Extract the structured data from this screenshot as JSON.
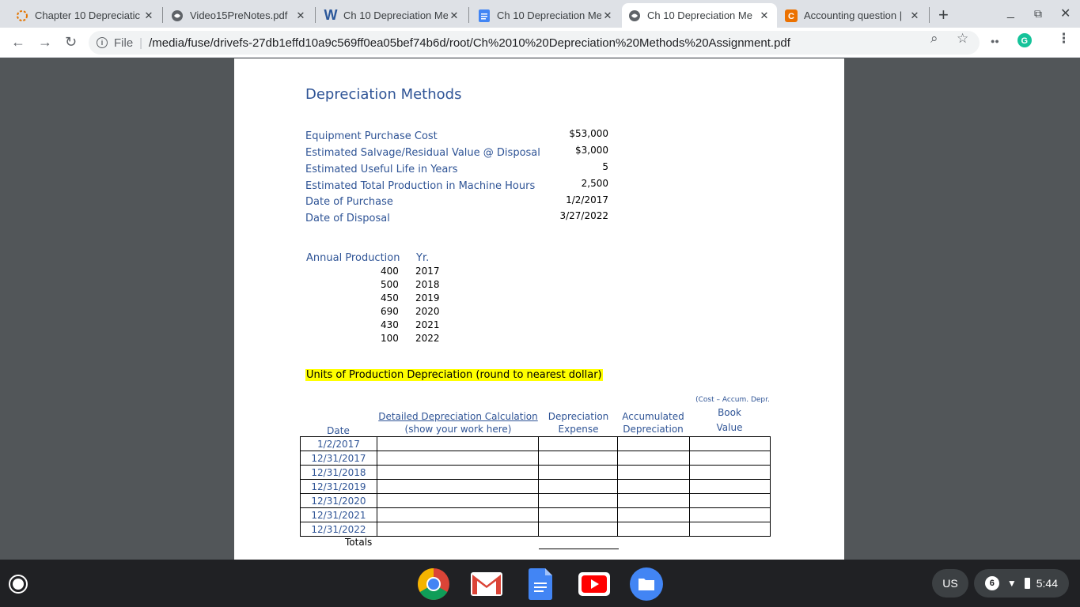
{
  "tabs": [
    {
      "title": "Chapter 10 Depreciatic",
      "icon": "loading-ring-icon",
      "active": false
    },
    {
      "title": "Video15PreNotes.pdf",
      "icon": "globe-icon",
      "active": false
    },
    {
      "title": "Ch 10 Depreciation Me",
      "icon": "word-icon",
      "active": false
    },
    {
      "title": "Ch 10 Depreciation Me",
      "icon": "google-docs-icon",
      "active": false
    },
    {
      "title": "Ch 10 Depreciation Me",
      "icon": "globe-icon",
      "active": true
    },
    {
      "title": "Accounting question |",
      "icon": "chegg-icon",
      "active": false
    }
  ],
  "toolbar": {
    "file_label": "File",
    "url": "/media/fuse/drivefs-27db1effd10a9c569ff0ea05bef74b6d/root/Ch%2010%20Depreciation%20Methods%20Assignment.pdf"
  },
  "doc": {
    "title": "Depreciation Methods",
    "info": [
      {
        "label": "Equipment Purchase Cost",
        "value": "$53,000"
      },
      {
        "label": "Estimated Salvage/Residual Value @ Disposal",
        "value": "$3,000"
      },
      {
        "label": "Estimated Useful Life in Years",
        "value": "5"
      },
      {
        "label": "Estimated Total Production in Machine Hours",
        "value": "2,500"
      },
      {
        "label": "Date of Purchase",
        "value": "1/2/2017"
      },
      {
        "label": "Date of Disposal",
        "value": "3/27/2022"
      }
    ],
    "production_header": {
      "production": "Annual Production",
      "year": "Yr."
    },
    "production": [
      {
        "hours": "400",
        "year": "2017"
      },
      {
        "hours": "500",
        "year": "2018"
      },
      {
        "hours": "450",
        "year": "2019"
      },
      {
        "hours": "690",
        "year": "2020"
      },
      {
        "hours": "430",
        "year": "2021"
      },
      {
        "hours": "100",
        "year": "2022"
      }
    ],
    "units_title": "Units of Production Depreciation (round to nearest dollar)",
    "columns": {
      "date": "Date",
      "calc_line1": "Detailed Depreciation Calculation",
      "calc_line2": "(show your work here)",
      "exp_line1": "Depreciation",
      "exp_line2": "Expense",
      "acc_line1": "Accumulated",
      "acc_line2": "Depreciation",
      "book_note": "(Cost – Accum. Depr.",
      "book_line1": "Book",
      "book_line2": "Value"
    },
    "dates": [
      "1/2/2017",
      "12/31/2017",
      "12/31/2018",
      "12/31/2019",
      "12/31/2020",
      "12/31/2021",
      "12/31/2022"
    ],
    "totals_label": "Totals"
  },
  "shelf": {
    "ime": "US",
    "notification_count": "6",
    "time": "5:44"
  }
}
